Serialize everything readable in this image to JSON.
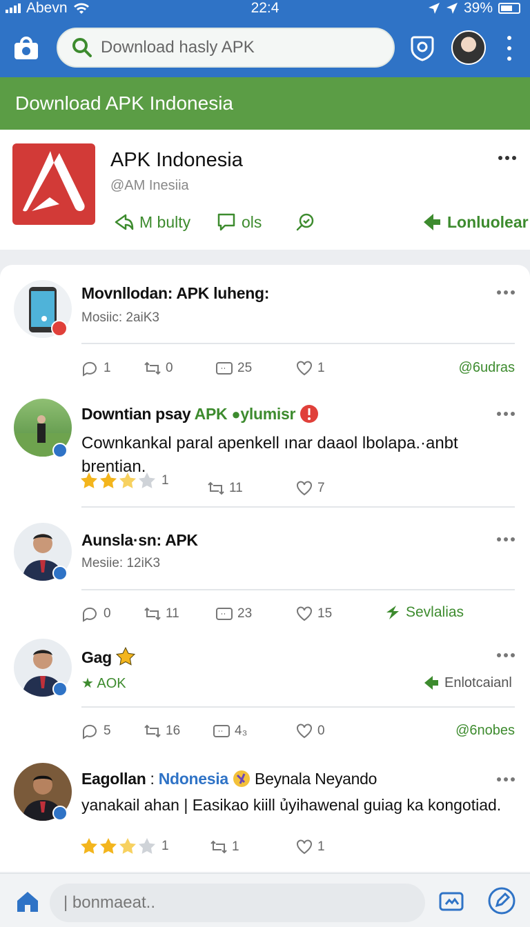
{
  "status": {
    "carrier": "Abevn",
    "time": "22:4",
    "battery": "39%"
  },
  "header": {
    "search_placeholder": "Download hasly APK"
  },
  "banner": {
    "title": "Download APK Indonesia"
  },
  "profile": {
    "name": "APK Indonesia",
    "handle": "@AM Inesiia",
    "actions": [
      {
        "label": "M bulty",
        "icon": "share-icon"
      },
      {
        "label": "ols",
        "icon": "comment-icon"
      },
      {
        "label": "",
        "icon": "search-icon"
      },
      {
        "label": "Lonluolear",
        "icon": "download-icon"
      }
    ]
  },
  "posts": [
    {
      "title": "Movnllodan: APK luheng:",
      "subtitle": "Mosiic: 2aiK3",
      "replies": "1",
      "reposts": "0",
      "views": "25",
      "likes": "1",
      "tag": "@6udras"
    },
    {
      "title_a": "Downtian psay",
      "title_b": "APK",
      "title_c": "ylumisr",
      "body": "Cownkankal paral apenkell ınar daaol lbolapa.·anbt brentian.",
      "rating": "1",
      "reposts": "11",
      "likes": "7"
    },
    {
      "title": "Aunsla·sn: APK",
      "subtitle": "Mesiie: 12iK3",
      "replies": "0",
      "reposts": "11",
      "views": "23",
      "likes": "15",
      "tag": "Sevlalias"
    },
    {
      "title": "Gag",
      "subtitle": "AOK",
      "tag_inline": "Enlotcaianl",
      "replies": "5",
      "reposts": "16",
      "views": "4₃",
      "likes": "0",
      "tag": "@6nobes"
    },
    {
      "title_a": "Eagollan",
      "title_sep": ":",
      "title_b": "Ndonesia",
      "title_c": "Beynala Neyando",
      "body": "yanakail ahan | Easikao kiill ủyihawenal guiag ka kongotiad.",
      "rating": "1",
      "reposts": "1",
      "likes": "1"
    }
  ],
  "composer": {
    "placeholder": "| bonmaeat.."
  },
  "colors": {
    "header_blue": "#2f73c6",
    "banner_green": "#5b9d45",
    "accent_green": "#3d8b2e",
    "star": "#f3b51d"
  }
}
